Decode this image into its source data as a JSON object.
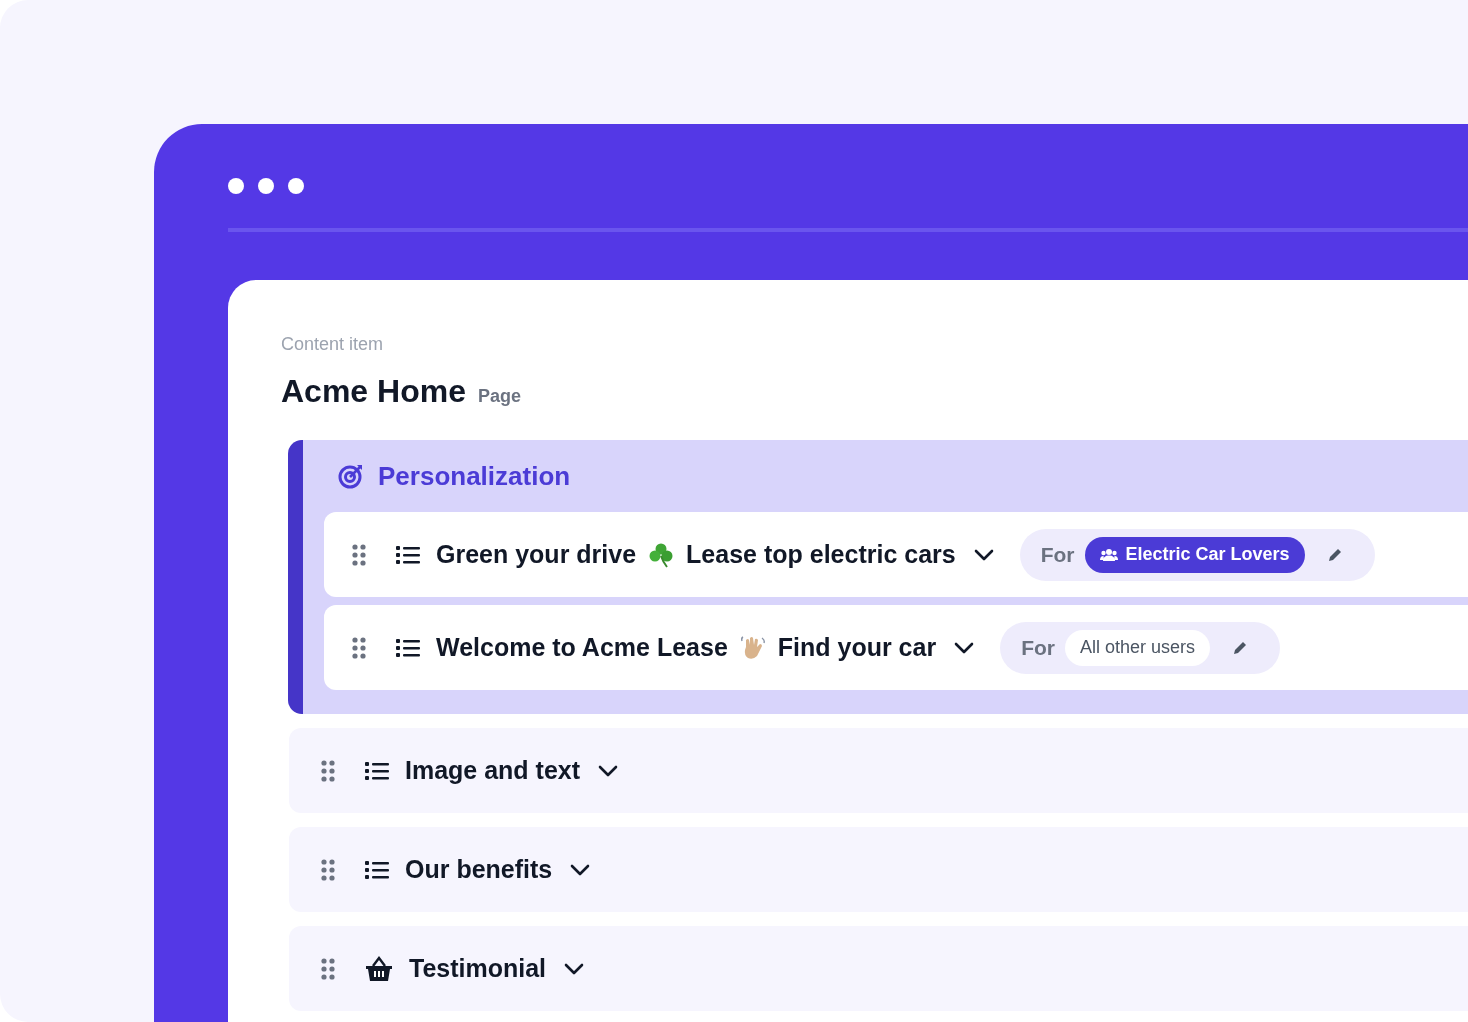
{
  "header": {
    "eyebrow": "Content item",
    "title": "Acme Home",
    "type": "Page"
  },
  "personalization": {
    "title": "Personalization",
    "variants": [
      {
        "kind": "list",
        "title_parts": [
          "Green your drive",
          "Lease top electric cars"
        ],
        "emoji": {
          "kind": "clover"
        },
        "for_label": "For",
        "audience": {
          "label": "Electric Car Lovers",
          "kind": "segment"
        }
      },
      {
        "kind": "list",
        "title_parts": [
          "Welcome to Acme Lease",
          "Find your car"
        ],
        "emoji": {
          "kind": "wave"
        },
        "for_label": "For",
        "audience": {
          "label": "All other users",
          "kind": "default"
        }
      }
    ]
  },
  "blocks": [
    {
      "kind": "list",
      "title": "Image and text"
    },
    {
      "kind": "list",
      "title": "Our benefits"
    },
    {
      "kind": "basket",
      "title": "Testimonial"
    }
  ]
}
